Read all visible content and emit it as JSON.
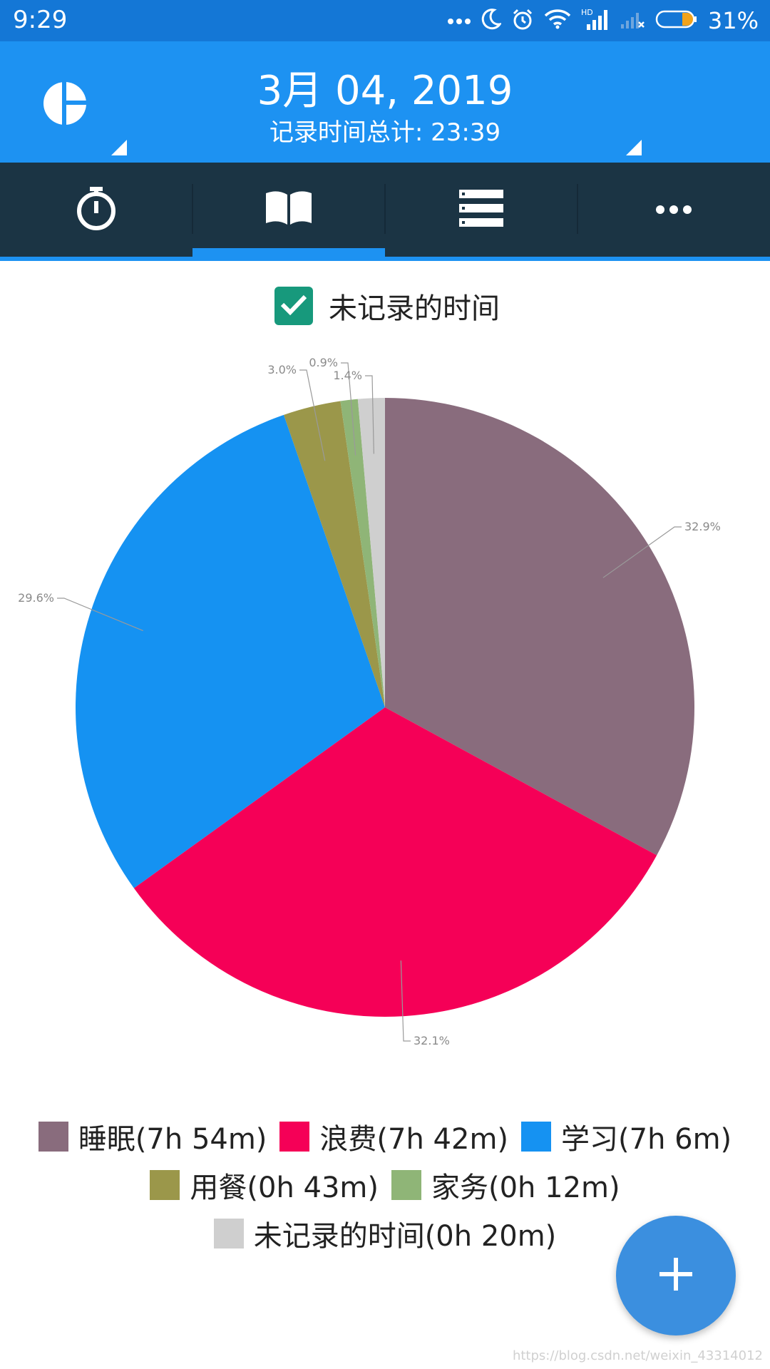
{
  "status_bar": {
    "time": "9:29",
    "battery_percent": "31%",
    "icons": [
      "more-dots-icon",
      "moon-icon",
      "alarm-icon",
      "wifi-icon",
      "hd-signal-icon",
      "no-signal-icon",
      "battery-icon"
    ]
  },
  "header": {
    "date": "3月 04, 2019",
    "total_line": "记录时间总计: 23:39",
    "logo_icon": "pie-chart-logo-icon",
    "color": "#1d92f2"
  },
  "tabs": [
    {
      "icon": "stopwatch-icon",
      "active": false
    },
    {
      "icon": "book-icon",
      "active": true
    },
    {
      "icon": "list-icon",
      "active": false
    },
    {
      "icon": "more-icon",
      "active": false
    }
  ],
  "unrecorded_toggle": {
    "label": "未记录的时间",
    "checked": true
  },
  "chart_data": {
    "type": "pie",
    "slices": [
      {
        "name": "睡眠",
        "percent": 32.9,
        "label": "32.9%",
        "color": "#896c7d"
      },
      {
        "name": "浪费",
        "percent": 32.1,
        "label": "32.1%",
        "color": "#f50057"
      },
      {
        "name": "学习",
        "percent": 29.6,
        "label": "29.6%",
        "color": "#1592f2"
      },
      {
        "name": "用餐",
        "percent": 3.0,
        "label": "3.0%",
        "color": "#9b974a"
      },
      {
        "name": "家务",
        "percent": 0.9,
        "label": "0.9%",
        "color": "#8fb577"
      },
      {
        "name": "未记录的时间",
        "percent": 1.4,
        "label": "1.4%",
        "color": "#cfcfcf"
      }
    ]
  },
  "legend": {
    "rows": [
      [
        {
          "text": "睡眠(7h 54m)",
          "color": "#896c7d"
        },
        {
          "text": "浪费(7h 42m)",
          "color": "#f50057"
        },
        {
          "text": "学习(7h 6m)",
          "color": "#1592f2"
        }
      ],
      [
        {
          "text": "用餐(0h 43m)",
          "color": "#9b974a"
        },
        {
          "text": "家务(0h 12m)",
          "color": "#8fb577"
        }
      ],
      [
        {
          "text": "未记录的时间(0h 20m)",
          "color": "#cfcfcf"
        }
      ]
    ]
  },
  "fab": {
    "icon": "plus-icon",
    "color": "#3b8fdf"
  },
  "watermark": "https://blog.csdn.net/weixin_43314012"
}
